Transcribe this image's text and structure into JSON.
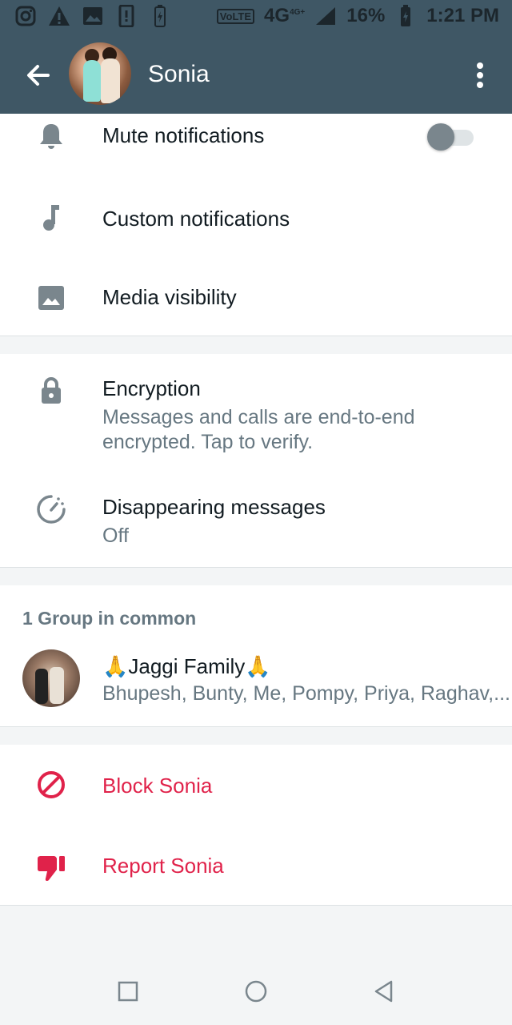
{
  "status_bar": {
    "network_badge": "VoLTE",
    "network_type": "4G",
    "network_sup": "4G+",
    "battery": "16%",
    "time": "1:21 PM"
  },
  "header": {
    "title": "Sonia"
  },
  "settings": {
    "mute_label": "Mute notifications",
    "mute_on": false,
    "custom_label": "Custom notifications",
    "media_label": "Media visibility"
  },
  "privacy": {
    "encryption_title": "Encryption",
    "encryption_line1": "Messages and calls are end-to-end",
    "encryption_line2": "encrypted. Tap to verify.",
    "disappearing_title": "Disappearing messages",
    "disappearing_value": "Off"
  },
  "groups": {
    "header": "1 Group in common",
    "items": [
      {
        "name": "🙏Jaggi Family🙏",
        "members": "Bhupesh, Bunty, Me, Pompy, Priya, Raghav,..."
      }
    ]
  },
  "actions": {
    "block_label": "Block Sonia",
    "report_label": "Report Sonia"
  },
  "colors": {
    "header_bg": "#3f5765",
    "danger": "#e0224a",
    "icon_gray": "#7a868d"
  }
}
